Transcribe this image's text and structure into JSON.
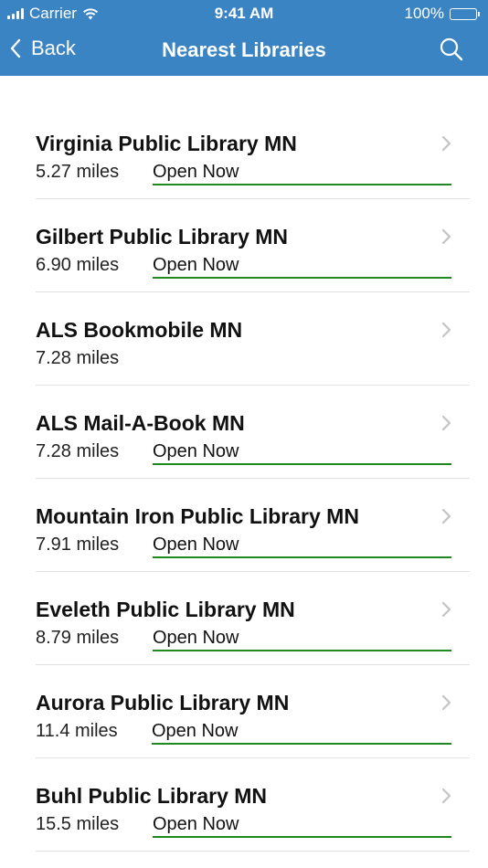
{
  "status_bar": {
    "carrier": "Carrier",
    "time": "9:41 AM",
    "battery": "100%"
  },
  "nav": {
    "back_label": "Back",
    "title": "Nearest Libraries",
    "search_icon": "search-icon"
  },
  "colors": {
    "header": "#3b84c4",
    "open_underline": "#1e8a1e"
  },
  "libraries": [
    {
      "name": "Virginia Public Library MN",
      "distance": "5.27 miles",
      "status": "Open Now"
    },
    {
      "name": "Gilbert Public Library MN",
      "distance": "6.90 miles",
      "status": "Open Now"
    },
    {
      "name": "ALS Bookmobile MN",
      "distance": "7.28 miles",
      "status": ""
    },
    {
      "name": "ALS Mail-A-Book MN",
      "distance": "7.28 miles",
      "status": "Open Now"
    },
    {
      "name": "Mountain Iron Public Library MN",
      "distance": "7.91 miles",
      "status": "Open Now"
    },
    {
      "name": "Eveleth Public Library MN",
      "distance": "8.79 miles",
      "status": "Open Now"
    },
    {
      "name": "Aurora Public Library MN",
      "distance": "11.4 miles",
      "status": "Open Now"
    },
    {
      "name": "Buhl Public Library MN",
      "distance": "15.5 miles",
      "status": "Open Now"
    }
  ]
}
